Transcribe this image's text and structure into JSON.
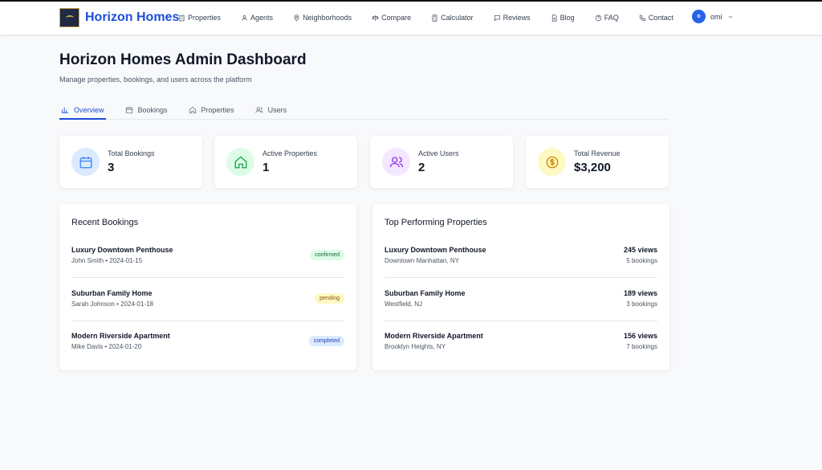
{
  "brand": {
    "name": "Horizon Homes"
  },
  "nav": [
    {
      "label": "Properties",
      "icon": "building-icon"
    },
    {
      "label": "Agents",
      "icon": "agents-icon"
    },
    {
      "label": "Neighborhoods",
      "icon": "map-pin-icon"
    },
    {
      "label": "Compare",
      "icon": "scale-icon"
    },
    {
      "label": "Calculator",
      "icon": "calculator-icon"
    },
    {
      "label": "Reviews",
      "icon": "message-icon"
    },
    {
      "label": "Blog",
      "icon": "document-icon"
    },
    {
      "label": "FAQ",
      "icon": "help-icon"
    },
    {
      "label": "Contact",
      "icon": "phone-icon"
    }
  ],
  "user": {
    "initial": "o",
    "name": "omi"
  },
  "page": {
    "title": "Horizon Homes Admin Dashboard",
    "subtitle": "Manage properties, bookings, and users across the platform"
  },
  "tabs": [
    {
      "label": "Overview",
      "active": true
    },
    {
      "label": "Bookings"
    },
    {
      "label": "Properties"
    },
    {
      "label": "Users"
    }
  ],
  "stats": [
    {
      "label": "Total Bookings",
      "value": "3",
      "color": "#3b82f6",
      "bg": "#dbeafe"
    },
    {
      "label": "Active Properties",
      "value": "1",
      "color": "#16a34a",
      "bg": "#dcfce7"
    },
    {
      "label": "Active Users",
      "value": "2",
      "color": "#9333ea",
      "bg": "#f3e8ff"
    },
    {
      "label": "Total Revenue",
      "value": "$3,200",
      "color": "#ca8a04",
      "bg": "#fef9c3"
    }
  ],
  "recent_bookings": {
    "title": "Recent Bookings",
    "items": [
      {
        "name": "Luxury Downtown Penthouse",
        "sub": "John Smith • 2024-01-15",
        "status": "confirmed",
        "status_color": "#166534",
        "status_bg": "#dcfce7"
      },
      {
        "name": "Suburban Family Home",
        "sub": "Sarah Johnson • 2024-01-18",
        "status": "pending",
        "status_color": "#854d0e",
        "status_bg": "#fef9c3"
      },
      {
        "name": "Modern Riverside Apartment",
        "sub": "Mike Davis • 2024-01-20",
        "status": "completed",
        "status_color": "#1e40af",
        "status_bg": "#dbeafe"
      }
    ]
  },
  "top_properties": {
    "title": "Top Performing Properties",
    "items": [
      {
        "name": "Luxury Downtown Penthouse",
        "location": "Downtown Manhattan, NY",
        "views": "245 views",
        "bookings": "5 bookings"
      },
      {
        "name": "Suburban Family Home",
        "location": "Westfield, NJ",
        "views": "189 views",
        "bookings": "3 bookings"
      },
      {
        "name": "Modern Riverside Apartment",
        "location": "Brooklyn Heights, NY",
        "views": "156 views",
        "bookings": "7 bookings"
      }
    ]
  }
}
